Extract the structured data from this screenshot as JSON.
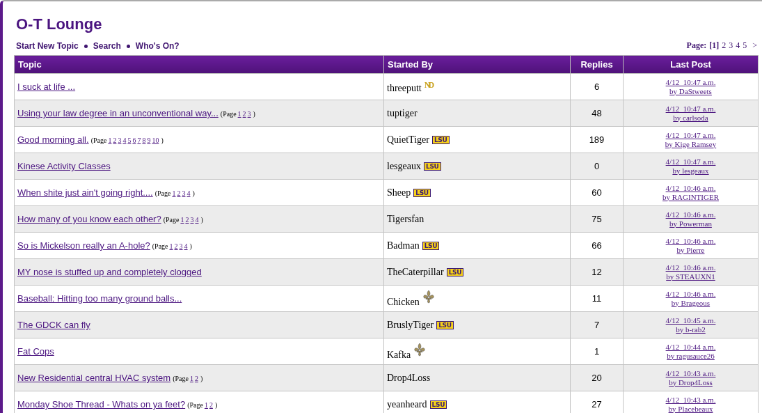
{
  "title": "O-T Lounge",
  "nav_links": [
    "Start New Topic",
    "Search",
    "Who's On?"
  ],
  "pagination": {
    "label": "Page:",
    "pages": [
      {
        "label": "[1]",
        "selected": true
      },
      {
        "label": "2",
        "selected": false
      },
      {
        "label": "3",
        "selected": false
      },
      {
        "label": "4",
        "selected": false
      },
      {
        "label": "5",
        "selected": false
      }
    ],
    "next": ">"
  },
  "table": {
    "columns": [
      "Topic",
      "Started By",
      "Replies",
      "Last Post"
    ],
    "rows": [
      {
        "topic": "I suck at life ...",
        "author": "threeputt",
        "badge": {
          "kind": "monogram",
          "text": "ND"
        },
        "replies": "6",
        "last_time": "4/12  10:47 a.m.",
        "last_by": "by DaStweets"
      },
      {
        "topic": "Using your law degree in an unconventional way...",
        "topic_pages": {
          "prefix": "(Page",
          "pages": [
            "1",
            "2",
            "3"
          ],
          "suffix": ")"
        },
        "author": "tuptiger",
        "replies": "48",
        "last_time": "4/12  10:47 a.m.",
        "last_by": "by carlsoda"
      },
      {
        "topic": "Good morning all.",
        "topic_pages": {
          "prefix": "(Page",
          "pages": [
            "1",
            "2",
            "3",
            "4",
            "5",
            "6",
            "7",
            "8",
            "9",
            "10"
          ],
          "suffix": ")"
        },
        "author": "QuietTiger",
        "badge": {
          "kind": "wordmark",
          "text": "LSU"
        },
        "replies": "189",
        "last_time": "4/12  10:47 a.m.",
        "last_by": "by Kige Ramsey"
      },
      {
        "topic": "Kinese Activity Classes",
        "author": "lesgeaux",
        "badge": {
          "kind": "wordmark",
          "text": "LSU"
        },
        "replies": "0",
        "last_time": "4/12  10:47 a.m.",
        "last_by": "by lesgeaux"
      },
      {
        "topic": "When shite just ain't going right....",
        "topic_pages": {
          "prefix": "(Page",
          "pages": [
            "1",
            "2",
            "3",
            "4"
          ],
          "suffix": ")"
        },
        "author": "Sheep",
        "badge": {
          "kind": "wordmark",
          "text": "LSU"
        },
        "replies": "60",
        "last_time": "4/12  10:46 a.m.",
        "last_by": "by RAGINTIGER"
      },
      {
        "topic": "How many of you know each other?",
        "topic_pages": {
          "prefix": "(Page",
          "pages": [
            "1",
            "2",
            "3",
            "4"
          ],
          "suffix": ")"
        },
        "author": "Tigersfan",
        "replies": "75",
        "last_time": "4/12  10:46 a.m.",
        "last_by": "by Powerman"
      },
      {
        "topic": "So is Mickelson really an A-hole?",
        "topic_pages": {
          "prefix": "(Page",
          "pages": [
            "1",
            "2",
            "3",
            "4"
          ],
          "suffix": ")"
        },
        "author": "Badman",
        "badge": {
          "kind": "wordmark",
          "text": "LSU"
        },
        "replies": "66",
        "last_time": "4/12  10:46 a.m.",
        "last_by": "by Pierre"
      },
      {
        "topic": "MY nose is stuffed up and completely clogged",
        "author": "TheCaterpillar",
        "badge": {
          "kind": "wordmark",
          "text": "LSU"
        },
        "replies": "12",
        "last_time": "4/12  10:46 a.m.",
        "last_by": "by STEAUXN1"
      },
      {
        "topic": "Baseball: Hitting too many ground balls...",
        "author": "Chicken",
        "badge": {
          "kind": "fleur"
        },
        "replies": "11",
        "last_time": "4/12  10:46 a.m.",
        "last_by": "by Brageous"
      },
      {
        "topic": "The GDCK can fly",
        "author": "BruslyTiger",
        "badge": {
          "kind": "wordmark",
          "text": "LSU"
        },
        "replies": "7",
        "last_time": "4/12  10:45 a.m.",
        "last_by": "by b-rab2"
      },
      {
        "topic": "Fat Cops",
        "author": "Kafka",
        "badge": {
          "kind": "fleur"
        },
        "replies": "1",
        "last_time": "4/12  10:44 a.m.",
        "last_by": "by ragusauce26"
      },
      {
        "topic": "New Residential central HVAC system",
        "topic_pages": {
          "prefix": "(Page",
          "pages": [
            "1",
            "2"
          ],
          "suffix": ")"
        },
        "author": "Drop4Loss",
        "replies": "20",
        "last_time": "4/12  10:43 a.m.",
        "last_by": "by Drop4Loss"
      },
      {
        "topic": "Monday Shoe Thread - Whats on ya feet?",
        "topic_pages": {
          "prefix": "(Page",
          "pages": [
            "1",
            "2"
          ],
          "suffix": ")"
        },
        "author": "yeanheard",
        "badge": {
          "kind": "wordmark",
          "text": "LSU"
        },
        "replies": "27",
        "last_time": "4/12  10:43 a.m.",
        "last_by": "by Placebeaux"
      }
    ]
  }
}
